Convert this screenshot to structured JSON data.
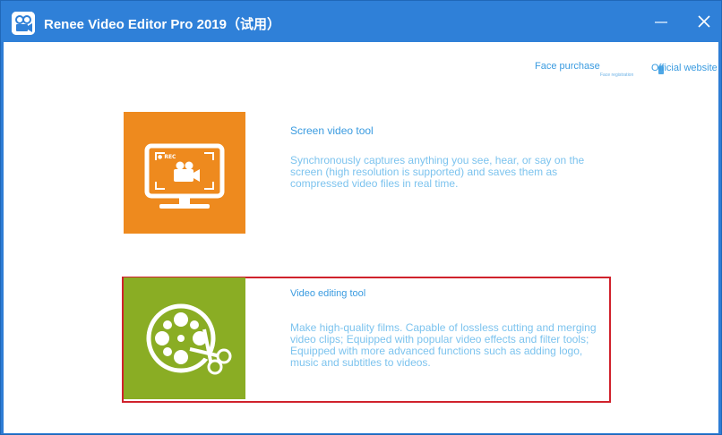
{
  "window": {
    "title": "Renee Video Editor Pro 2019（试用）",
    "colors": {
      "titlebar": "#2f80d8",
      "accent": "#3a9be0",
      "highlight": "#d0222c"
    }
  },
  "header_links": {
    "face_purchase": "Face purchase",
    "registration": "Face registration",
    "official_website": "Official website"
  },
  "tools": [
    {
      "title": "Screen video tool",
      "description": "Synchronously captures anything you see, hear, or say on the screen (high resolution is supported) and saves them as compressed video files in real time.",
      "icon": "screen-record-icon",
      "badge": "● REC",
      "color": "#ee8a1e"
    },
    {
      "title": "Video editing tool",
      "description": "Make high-quality films. Capable of lossless cutting and merging video clips; Equipped with popular video effects and filter tools; Equipped with more advanced functions such as adding logo, music and subtitles to videos.",
      "icon": "film-reel-scissors-icon",
      "color": "#8aad24"
    }
  ]
}
